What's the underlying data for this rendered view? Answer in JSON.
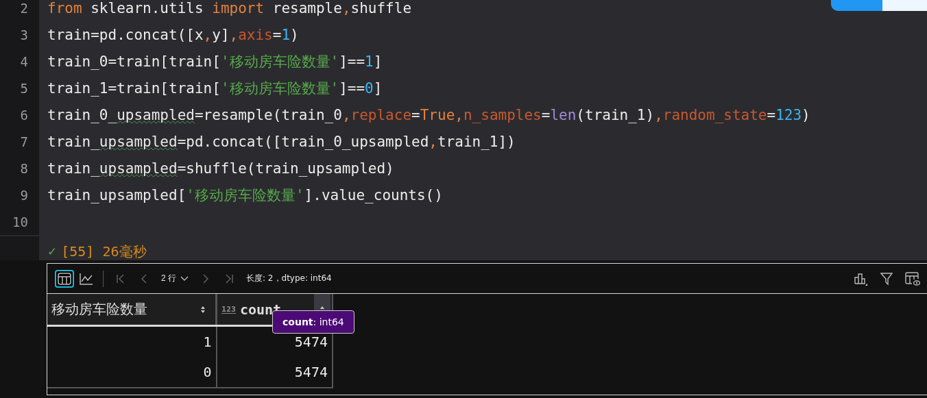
{
  "editor": {
    "lines": [
      {
        "number": "2",
        "tokens": [
          {
            "kind": "kw",
            "text": "from"
          },
          {
            "kind": "plain",
            "text": " sklearn.utils "
          },
          {
            "kind": "kw",
            "text": "import"
          },
          {
            "kind": "plain",
            "text": " resample"
          },
          {
            "kind": "punc",
            "text": ","
          },
          {
            "kind": "plain",
            "text": "shuffle"
          }
        ]
      },
      {
        "number": "3",
        "tokens": [
          {
            "kind": "plain",
            "text": "train=pd.concat([x"
          },
          {
            "kind": "punc",
            "text": ","
          },
          {
            "kind": "plain",
            "text": "y]"
          },
          {
            "kind": "punc",
            "text": ","
          },
          {
            "kind": "param",
            "text": "axis"
          },
          {
            "kind": "plain",
            "text": "="
          },
          {
            "kind": "num",
            "text": "1"
          },
          {
            "kind": "plain",
            "text": ")"
          }
        ]
      },
      {
        "number": "4",
        "tokens": [
          {
            "kind": "plain",
            "text": "train_0=train[train["
          },
          {
            "kind": "str",
            "text": "'移动房车险数量'"
          },
          {
            "kind": "plain",
            "text": "]=="
          },
          {
            "kind": "num",
            "text": "1"
          },
          {
            "kind": "plain",
            "text": "]"
          }
        ]
      },
      {
        "number": "5",
        "tokens": [
          {
            "kind": "plain",
            "text": "train_1=train[train["
          },
          {
            "kind": "str",
            "text": "'移动房车险数量'"
          },
          {
            "kind": "plain",
            "text": "]=="
          },
          {
            "kind": "num",
            "text": "0"
          },
          {
            "kind": "plain",
            "text": "]"
          }
        ]
      },
      {
        "number": "6",
        "tokens": [
          {
            "kind": "plain",
            "text": "train_0_"
          },
          {
            "kind": "spell",
            "text": "upsampled"
          },
          {
            "kind": "plain",
            "text": "=resample(train_0"
          },
          {
            "kind": "punc",
            "text": ","
          },
          {
            "kind": "param",
            "text": "replace"
          },
          {
            "kind": "plain",
            "text": "="
          },
          {
            "kind": "kw",
            "text": "True"
          },
          {
            "kind": "punc",
            "text": ","
          },
          {
            "kind": "param",
            "text": "n_samples"
          },
          {
            "kind": "plain",
            "text": "="
          },
          {
            "kind": "builtin",
            "text": "len"
          },
          {
            "kind": "plain",
            "text": "(train_1)"
          },
          {
            "kind": "punc",
            "text": ","
          },
          {
            "kind": "param",
            "text": "random_state"
          },
          {
            "kind": "plain",
            "text": "="
          },
          {
            "kind": "num",
            "text": "123"
          },
          {
            "kind": "plain",
            "text": ")"
          }
        ]
      },
      {
        "number": "7",
        "tokens": [
          {
            "kind": "plain",
            "text": "train_"
          },
          {
            "kind": "spell",
            "text": "upsampled"
          },
          {
            "kind": "plain",
            "text": "=pd.concat([train_0_upsampled"
          },
          {
            "kind": "punc",
            "text": ","
          },
          {
            "kind": "plain",
            "text": "train_1])"
          }
        ]
      },
      {
        "number": "8",
        "tokens": [
          {
            "kind": "plain",
            "text": "train_"
          },
          {
            "kind": "spell",
            "text": "upsampled"
          },
          {
            "kind": "plain",
            "text": "=shuffle(train_upsampled)"
          }
        ]
      },
      {
        "number": "9",
        "tokens": [
          {
            "kind": "plain",
            "text": "train_upsampled["
          },
          {
            "kind": "str",
            "text": "'移动房车险数量'"
          },
          {
            "kind": "plain",
            "text": "].value_counts()"
          }
        ]
      },
      {
        "number": "10"
      }
    ],
    "status": {
      "check": "✓",
      "text": "[55] 26毫秒"
    }
  },
  "output": {
    "toolbar": {
      "table_view": {
        "selected": true
      },
      "chart_view": {
        "selected": false
      },
      "rows": "2 行",
      "info": "长度: 2，dtype: int64"
    },
    "table": {
      "columns": [
        {
          "label": "移动房车险数量"
        },
        {
          "label": "count",
          "type_label": "123"
        }
      ],
      "rows": [
        [
          "1",
          "5474"
        ],
        [
          "0",
          "5474"
        ]
      ]
    },
    "tooltip": {
      "name": "count",
      "type": ": int64"
    }
  }
}
